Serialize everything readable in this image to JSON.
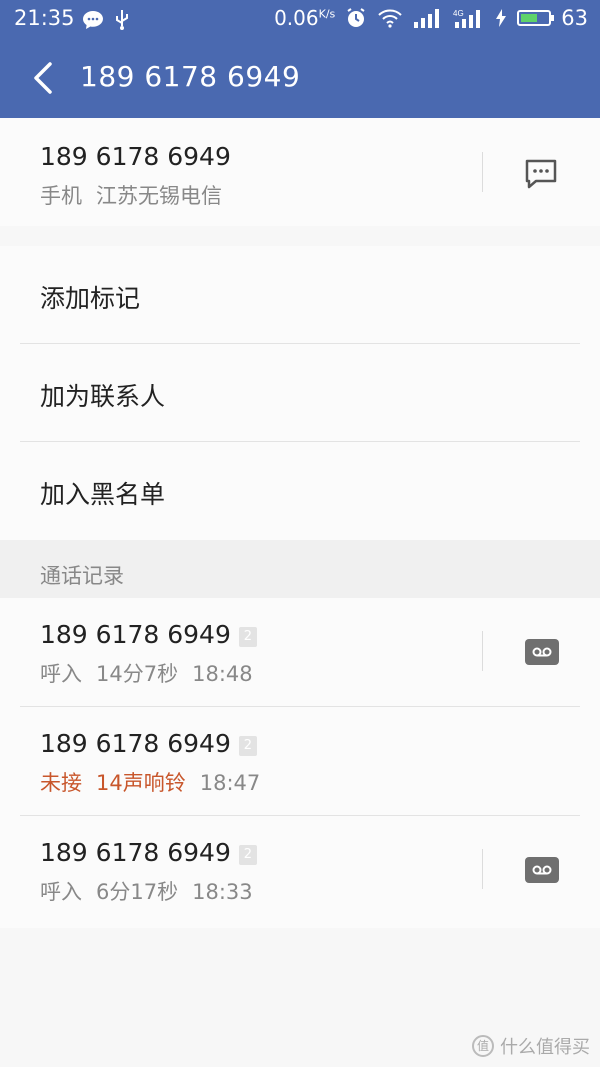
{
  "status_bar": {
    "time": "21:35",
    "speed_value": "0.06",
    "speed_unit": "K/s",
    "network": "4G",
    "battery_percent": "63",
    "battery_level": 0.63
  },
  "app_bar": {
    "back_icon": "back-arrow-icon",
    "title": "189 6178 6949"
  },
  "contact": {
    "number": "189 6178 6949",
    "type": "手机",
    "location": "江苏无锡电信",
    "message_icon": "message-bubble-icon"
  },
  "actions": [
    {
      "label": "添加标记"
    },
    {
      "label": "加为联系人"
    },
    {
      "label": "加入黑名单"
    }
  ],
  "call_log": {
    "header": "通话记录",
    "entries": [
      {
        "number": "189 6178 6949",
        "sim": "2",
        "type": "呼入",
        "detail": "14分7秒",
        "time": "18:48",
        "recording": true
      },
      {
        "number": "189 6178 6949",
        "sim": "2",
        "type": "未接",
        "detail": "14声响铃",
        "time": "18:47",
        "recording": false
      },
      {
        "number": "189 6178 6949",
        "sim": "2",
        "type": "呼入",
        "detail": "6分17秒",
        "time": "18:33",
        "recording": true
      }
    ]
  },
  "watermark": {
    "badge": "值",
    "text": "什么值得买"
  },
  "colors": {
    "app_bar": "#4a69b0",
    "missed": "#c8562b",
    "battery_fill": "#5fd36a"
  }
}
